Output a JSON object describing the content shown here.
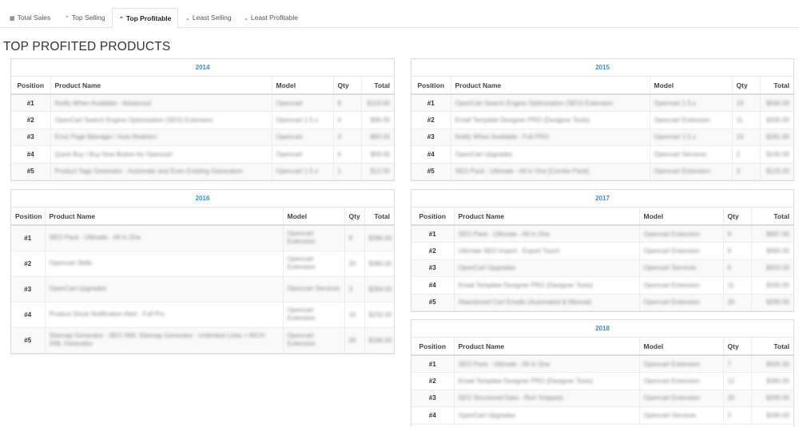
{
  "tabs": [
    {
      "label": "Total Sales",
      "icon": "table-icon",
      "glyph": "▦"
    },
    {
      "label": "Top Selling",
      "icon": "chevron-up-icon",
      "glyph": "⌃"
    },
    {
      "label": "Top Profitable",
      "icon": "chevron-up-icon",
      "glyph": "⌃",
      "active": true
    },
    {
      "label": "Least Selling",
      "icon": "chevron-down-icon",
      "glyph": "⌄"
    },
    {
      "label": "Least Profitable",
      "icon": "chevron-down-icon",
      "glyph": "⌄"
    }
  ],
  "page_title": "TOP PROFITED PRODUCTS",
  "columns": {
    "position": "Position",
    "product": "Product Name",
    "model": "Model",
    "qty": "Qty",
    "total": "Total"
  },
  "colors": {
    "year": "#3a8fd0",
    "border": "#dcdcdc"
  },
  "panels": [
    {
      "year": "2014",
      "rows": [
        {
          "pos": "#1",
          "name": "Notify When Available - Advanced",
          "model": "Opencart",
          "qty": "8",
          "total": "$119.00"
        },
        {
          "pos": "#2",
          "name": "OpenCart Search Engine Optimization (SEO) Extension",
          "model": "Opencart 1.5.x",
          "qty": "4",
          "total": "$96.00"
        },
        {
          "pos": "#3",
          "name": "Error Page Manager / Auto Redirect",
          "model": "Opencart",
          "qty": "3",
          "total": "$60.00"
        },
        {
          "pos": "#4",
          "name": "Quick Buy / Buy Now Button for Opencart",
          "model": "Opencart",
          "qty": "4",
          "total": "$59.00"
        },
        {
          "pos": "#5",
          "name": "Product Tags Generator - Automatic and Even Existing Generation",
          "model": "Opencart 1.5.x",
          "qty": "1",
          "total": "$12.00"
        }
      ]
    },
    {
      "year": "2015",
      "rows": [
        {
          "pos": "#1",
          "name": "OpenCart Search Engine Optimization (SEO) Extension",
          "model": "Opencart 1.5.x",
          "qty": "19",
          "total": "$566.00"
        },
        {
          "pos": "#2",
          "name": "Email Template Designer PRO (Designer Tools)",
          "model": "Opencart Extension",
          "qty": "11",
          "total": "$330.00"
        },
        {
          "pos": "#3",
          "name": "Notify When Available - Full PRO",
          "model": "Opencart 1.5.x",
          "qty": "10",
          "total": "$281.00"
        },
        {
          "pos": "#4",
          "name": "OpenCart Upgrades",
          "model": "Opencart Services",
          "qty": "2",
          "total": "$140.00"
        },
        {
          "pos": "#5",
          "name": "SEO Pack - Ultimate - All in One [Combo Pack]",
          "model": "Opencart Extension",
          "qty": "3",
          "total": "$120.00"
        }
      ]
    },
    {
      "year": "2016",
      "rows": [
        {
          "pos": "#1",
          "name": "SEO Pack - Ultimate - All in One",
          "model": "Opencart Extension",
          "qty": "9",
          "total": "$386.00"
        },
        {
          "pos": "#2",
          "name": "Opencart Skills",
          "model": "Opencart Extension",
          "qty": "20",
          "total": "$380.00"
        },
        {
          "pos": "#3",
          "name": "OpenCart Upgrades",
          "model": "Opencart Services",
          "qty": "3",
          "total": "$284.00"
        },
        {
          "pos": "#4",
          "name": "Product Stock Notification Alert - Full Pro",
          "model": "Opencart Extension",
          "qty": "15",
          "total": "$232.00"
        },
        {
          "pos": "#5",
          "name": "Sitemap Generator - SEO XML Sitemap Generator - Unlimited Links + RICH XML Generator",
          "model": "Opencart Extension",
          "qty": "20",
          "total": "$196.00"
        }
      ]
    },
    {
      "year": "2017",
      "rows": [
        {
          "pos": "#1",
          "name": "SEO Pack - Ultimate - All in One",
          "model": "Opencart Extension",
          "qty": "9",
          "total": "$697.00"
        },
        {
          "pos": "#2",
          "name": "Ultimate SEO Import - Export Touch",
          "model": "Opencart Extension",
          "qty": "9",
          "total": "$460.00"
        },
        {
          "pos": "#3",
          "name": "OpenCart Upgrades",
          "model": "Opencart Services",
          "qty": "6",
          "total": "$420.00"
        },
        {
          "pos": "#4",
          "name": "Email Template Designer PRO (Designer Tools)",
          "model": "Opencart Extension",
          "qty": "11",
          "total": "$330.00"
        },
        {
          "pos": "#5",
          "name": "Abandoned Cart Emails (Automated & Manual)",
          "model": "Opencart Extension",
          "qty": "20",
          "total": "$290.00"
        }
      ]
    },
    {
      "year": "2018",
      "rows": [
        {
          "pos": "#1",
          "name": "SEO Pack - Ultimate - All in One",
          "model": "Opencart Extension",
          "qty": "7",
          "total": "$505.00"
        },
        {
          "pos": "#2",
          "name": "Email Template Designer PRO (Designer Tools)",
          "model": "Opencart Extension",
          "qty": "12",
          "total": "$360.00"
        },
        {
          "pos": "#3",
          "name": "SEO Structured Data - Rich Snippets",
          "model": "Opencart Extension",
          "qty": "20",
          "total": "$290.00"
        },
        {
          "pos": "#4",
          "name": "OpenCart Upgrades",
          "model": "Opencart Services",
          "qty": "3",
          "total": "$280.00"
        }
      ]
    }
  ]
}
